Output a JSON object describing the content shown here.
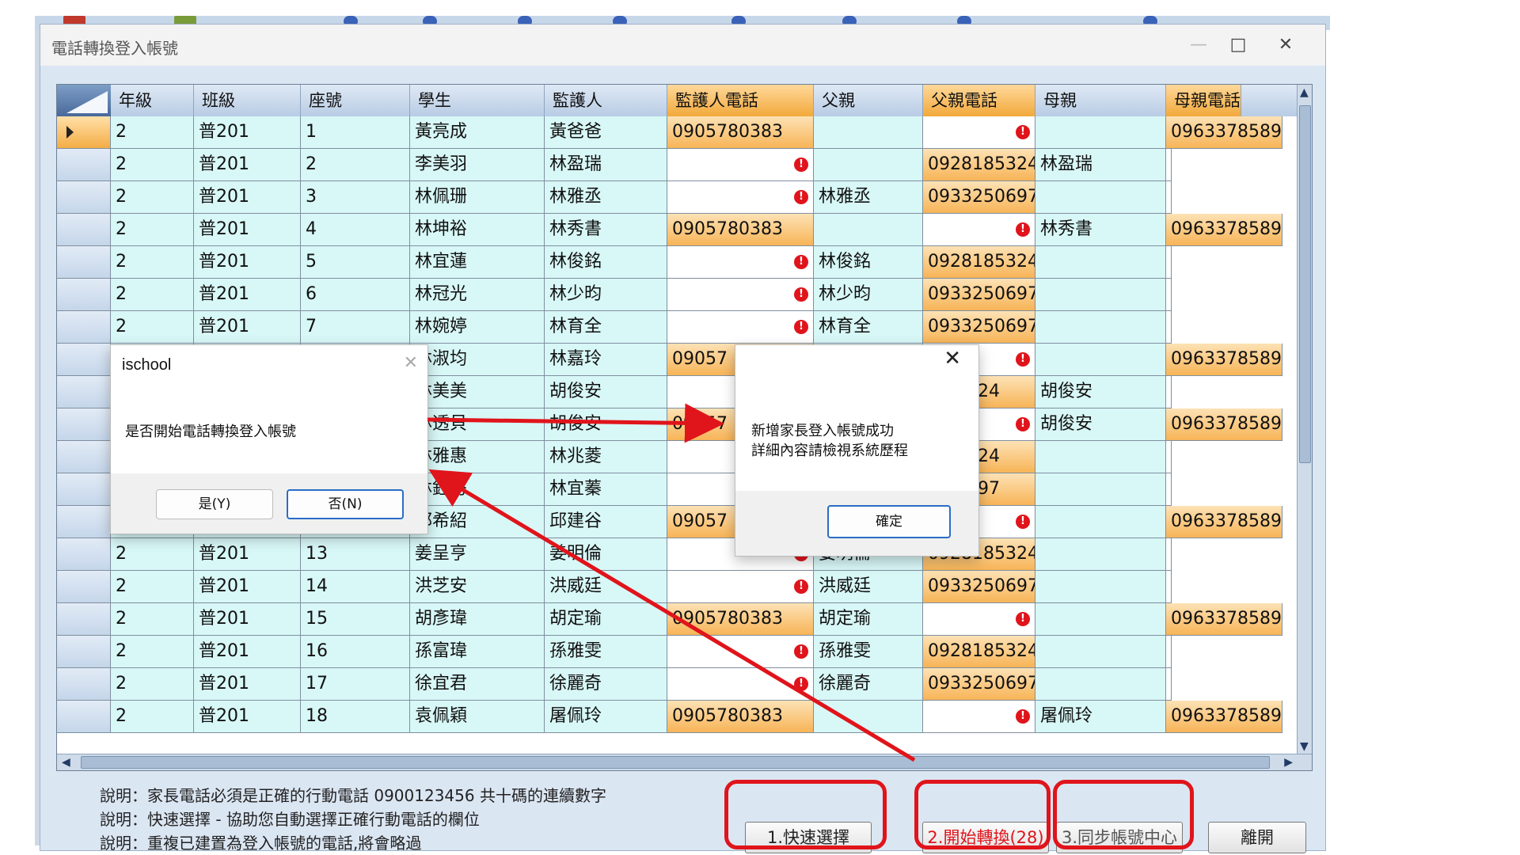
{
  "window": {
    "title": "電話轉換登入帳號",
    "minimize_glyph": "—",
    "maximize_glyph": "□",
    "close_glyph": "✕"
  },
  "grid": {
    "columns": [
      "年級",
      "班級",
      "座號",
      "學生",
      "監護人",
      "監護人電話",
      "父親",
      "父親電話",
      "母親",
      "母親電話"
    ],
    "rows": [
      {
        "grade": "2",
        "cls": "普201",
        "seat": "1",
        "student": "黃亮成",
        "guardian": "黃爸爸",
        "gphone": "0905780383",
        "father": "",
        "fphone": "",
        "mother": "",
        "mphone": "0963378589"
      },
      {
        "grade": "2",
        "cls": "普201",
        "seat": "2",
        "student": "李美羽",
        "guardian": "林盈瑞",
        "gphone": "",
        "father": "",
        "fphone": "0928185324",
        "mother": "林盈瑞",
        "mphone": ""
      },
      {
        "grade": "2",
        "cls": "普201",
        "seat": "3",
        "student": "林佩珊",
        "guardian": "林雅丞",
        "gphone": "",
        "father": "林雅丞",
        "fphone": "0933250697",
        "mother": "",
        "mphone": ""
      },
      {
        "grade": "2",
        "cls": "普201",
        "seat": "4",
        "student": "林坤裕",
        "guardian": "林秀書",
        "gphone": "0905780383",
        "father": "",
        "fphone": "",
        "mother": "林秀書",
        "mphone": "0963378589"
      },
      {
        "grade": "2",
        "cls": "普201",
        "seat": "5",
        "student": "林宜蓮",
        "guardian": "林俊銘",
        "gphone": "",
        "father": "林俊銘",
        "fphone": "0928185324",
        "mother": "",
        "mphone": ""
      },
      {
        "grade": "2",
        "cls": "普201",
        "seat": "6",
        "student": "林冠光",
        "guardian": "林少昀",
        "gphone": "",
        "father": "林少昀",
        "fphone": "0933250697",
        "mother": "",
        "mphone": ""
      },
      {
        "grade": "2",
        "cls": "普201",
        "seat": "7",
        "student": "林婉婷",
        "guardian": "林育全",
        "gphone": "",
        "father": "林育全",
        "fphone": "0933250697",
        "mother": "",
        "mphone": ""
      },
      {
        "grade": "",
        "cls": "",
        "seat": "",
        "student": "林淑均",
        "guardian": "林嘉玲",
        "gphone": "09057",
        "father": "",
        "fphone": "",
        "mother": "",
        "mphone": "0963378589"
      },
      {
        "grade": "",
        "cls": "",
        "seat": "",
        "student": "林美美",
        "guardian": "胡俊安",
        "gphone": "",
        "father": "",
        "fphone": "...35324",
        "mother": "胡俊安",
        "mphone": ""
      },
      {
        "grade": "",
        "cls": "",
        "seat": "",
        "student": "林透貝",
        "guardian": "胡俊安",
        "gphone": "09057",
        "father": "",
        "fphone": "",
        "mother": "胡俊安",
        "mphone": "0963378589"
      },
      {
        "grade": "",
        "cls": "",
        "seat": "",
        "student": "林雅惠",
        "guardian": "林兆菱",
        "gphone": "",
        "father": "",
        "fphone": "...35324",
        "mother": "",
        "mphone": ""
      },
      {
        "grade": "",
        "cls": "",
        "seat": "",
        "student": "林鈺秀",
        "guardian": "林宜蓁",
        "gphone": "",
        "father": "",
        "fphone": "...50697",
        "mother": "",
        "mphone": ""
      },
      {
        "grade": "",
        "cls": "",
        "seat": "",
        "student": "邱希紹",
        "guardian": "邱建谷",
        "gphone": "09057",
        "father": "",
        "fphone": "",
        "mother": "",
        "mphone": "0963378589"
      },
      {
        "grade": "2",
        "cls": "普201",
        "seat": "13",
        "student": "姜呈亨",
        "guardian": "姜明倫",
        "gphone": "",
        "father": "姜明倫",
        "fphone": "0928185324",
        "mother": "",
        "mphone": ""
      },
      {
        "grade": "2",
        "cls": "普201",
        "seat": "14",
        "student": "洪芝安",
        "guardian": "洪威廷",
        "gphone": "",
        "father": "洪威廷",
        "fphone": "0933250697",
        "mother": "",
        "mphone": ""
      },
      {
        "grade": "2",
        "cls": "普201",
        "seat": "15",
        "student": "胡彥瑋",
        "guardian": "胡定瑜",
        "gphone": "0905780383",
        "father": "胡定瑜",
        "fphone": "",
        "mother": "",
        "mphone": "0963378589"
      },
      {
        "grade": "2",
        "cls": "普201",
        "seat": "16",
        "student": "孫富瑋",
        "guardian": "孫雅雯",
        "gphone": "",
        "father": "孫雅雯",
        "fphone": "0928185324",
        "mother": "",
        "mphone": ""
      },
      {
        "grade": "2",
        "cls": "普201",
        "seat": "17",
        "student": "徐宜君",
        "guardian": "徐麗奇",
        "gphone": "",
        "father": "徐麗奇",
        "fphone": "0933250697",
        "mother": "",
        "mphone": ""
      },
      {
        "grade": "2",
        "cls": "普201",
        "seat": "18",
        "student": "袁佩穎",
        "guardian": "屠佩玲",
        "gphone": "0905780383",
        "father": "",
        "fphone": "",
        "mother": "屠佩玲",
        "mphone": "0963378589"
      }
    ]
  },
  "notes": [
    "說明：家長電話必須是正確的行動電話 0900123456 共十碼的連續數字",
    "說明：快速選擇 - 協助您自動選擇正確行動電話的欄位",
    "說明：重複已建置為登入帳號的電話,將會略過"
  ],
  "buttons": {
    "quick_select": "1.快速選擇",
    "start_convert": "2.開始轉換(28)",
    "sync_account": "3.同步帳號中心",
    "leave": "離開"
  },
  "dialog_confirm": {
    "title": "ischool",
    "message": "是否開始電話轉換登入帳號",
    "yes": "是(Y)",
    "no": "否(N)",
    "close": "✕"
  },
  "dialog_success": {
    "line1": "新增家長登入帳號成功",
    "line2": "詳細內容請檢視系統歷程",
    "ok": "確定",
    "close": "✕"
  },
  "colors": {
    "highlight": "#e0141b",
    "cell_bg": "#d8f7f7",
    "orange": "#f7b457",
    "error_icon": "#e0141b"
  }
}
